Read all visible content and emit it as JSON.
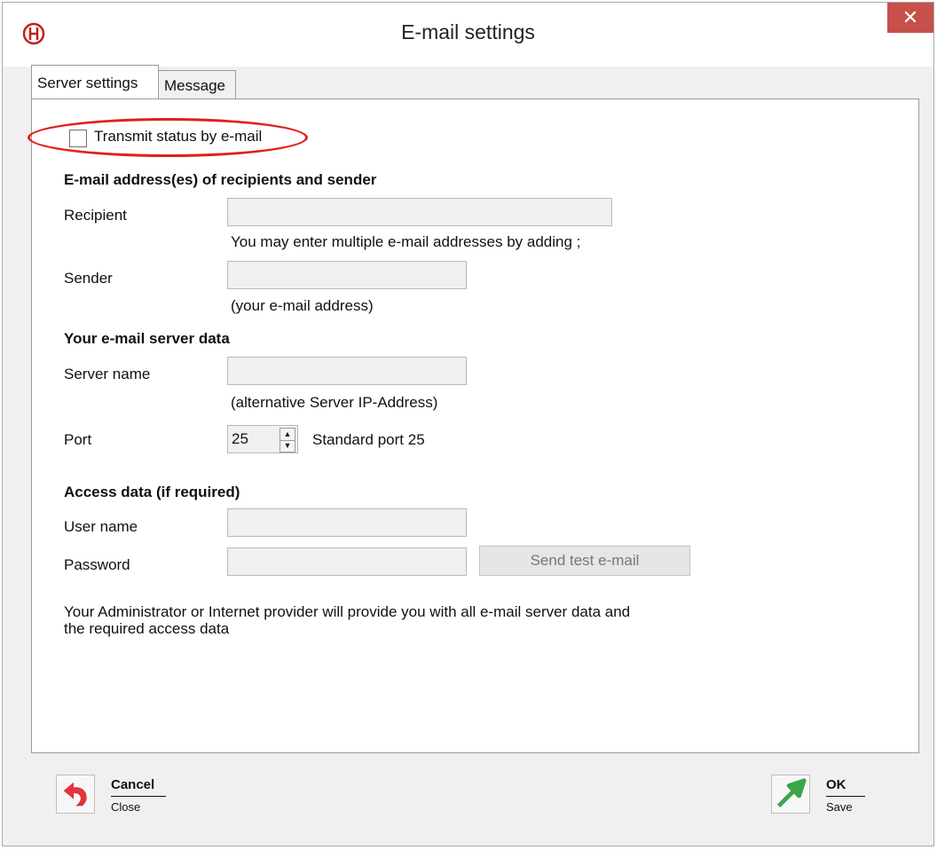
{
  "window": {
    "title": "E-mail settings",
    "close_glyph": "✕"
  },
  "tabs": [
    {
      "label": "Server settings",
      "active": true
    },
    {
      "label": "Message",
      "active": false
    }
  ],
  "transmit": {
    "label": "Transmit status by e-mail",
    "checked": false
  },
  "section_addresses": {
    "heading": "E-mail address(es) of recipients and sender",
    "recipient_label": "Recipient",
    "recipient_value": "",
    "recipient_hint": "You may enter multiple e-mail addresses by adding ;",
    "sender_label": "Sender",
    "sender_value": "",
    "sender_hint": "(your e-mail address)"
  },
  "section_server": {
    "heading": "Your e-mail server data",
    "server_label": "Server name",
    "server_value": "",
    "server_hint": "(alternative Server IP-Address)",
    "port_label": "Port",
    "port_value": "25",
    "port_hint": "Standard port 25"
  },
  "section_access": {
    "heading": "Access data (if required)",
    "user_label": "User name",
    "user_value": "",
    "password_label": "Password",
    "password_value": "",
    "test_button": "Send test e-mail"
  },
  "note": {
    "line1": "Your Administrator or Internet provider will provide you with all e-mail server data and",
    "line2": "the required access data"
  },
  "footer": {
    "cancel_label": "Cancel",
    "cancel_sub": "Close",
    "ok_label": "OK",
    "ok_sub": "Save"
  },
  "colors": {
    "highlight": "#e0201a",
    "close_button": "#c7504a",
    "cancel_icon": "#e2343c",
    "ok_icon": "#3aa648"
  },
  "icons": {
    "app": "app-logo-icon",
    "close": "close-icon",
    "cancel": "undo-arrow-icon",
    "ok": "arrow-up-right-icon",
    "spin_up": "spin-up-icon",
    "spin_down": "spin-down-icon"
  }
}
